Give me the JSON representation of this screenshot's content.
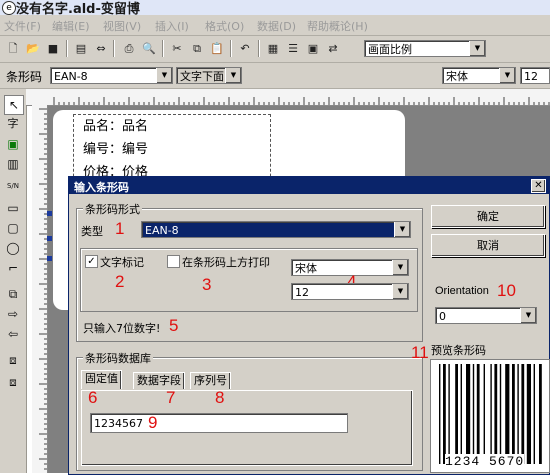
{
  "window": {
    "title": "没有名字.ald-变留博"
  },
  "menu": [
    "文件(F)",
    "编辑(E)",
    "视图(V)",
    "插入(I)",
    "格式(O)",
    "数据(D)",
    "帮助概论(H)"
  ],
  "toolbar": {
    "zoom_value": "画面比例"
  },
  "formatbar": {
    "label": "条形码",
    "barcode_type": "EAN-8",
    "text_position": "文字下面",
    "font": "宋体",
    "size": "12"
  },
  "page": {
    "lines": [
      "品名：品名",
      "编号：编号",
      "价格：价格"
    ]
  },
  "dialog": {
    "title": "输入条形码",
    "group_format": "条形码形式",
    "type_label": "类型",
    "type_value": "EAN-8",
    "text_mark": "文字标记",
    "print_above": "在条形码上方打印",
    "font": "宋体",
    "size": "12",
    "hint": "只输入7位数字!",
    "group_db": "条形码数据库",
    "tabs": [
      "固定值",
      "数据字段",
      "序列号"
    ],
    "input_value": "1234567",
    "ok": "确定",
    "cancel": "取消",
    "orientation_label": "Orientation",
    "orientation_value": "0",
    "preview_label": "预览条形码",
    "barcode_text": "1234 5670"
  },
  "annotations": [
    "1",
    "2",
    "3",
    "4",
    "5",
    "6",
    "7",
    "8",
    "9",
    "10",
    "11"
  ]
}
